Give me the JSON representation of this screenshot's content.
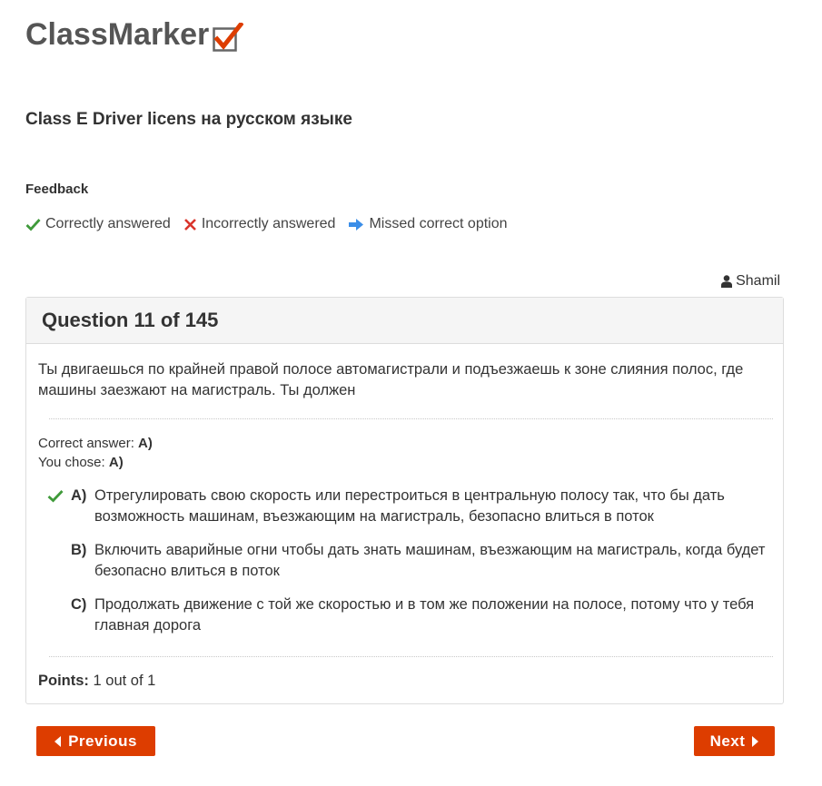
{
  "brand": {
    "logo_text": "ClassMarker",
    "accent_color": "#dd3d00"
  },
  "test": {
    "title": "Class E Driver licens на русском языке"
  },
  "feedback": {
    "title": "Feedback",
    "legend": {
      "correct": "Correctly answered",
      "incorrect": "Incorrectly answered",
      "missed": "Missed correct option"
    }
  },
  "user": {
    "name": "Shamil",
    "icon": "user-icon"
  },
  "question": {
    "heading": "Question 11 of 145",
    "text": "Ты двигаешься по крайней правой полосе автомагистрали и подъезжаешь к зоне слияния полос, где машины заезжают на магистраль. Ты должен",
    "correct_answer_label": "Correct answer:",
    "correct_answer_value": "A)",
    "you_chose_label": "You chose:",
    "you_chose_value": "A)",
    "options": [
      {
        "letter": "A)",
        "text": "Отрегулировать свою скорость или перестроиться в центральную полосу так, что бы дать возможность машинам, въезжающим на магистраль, безопасно влиться в поток",
        "mark": "check-icon"
      },
      {
        "letter": "B)",
        "text": "Включить аварийные огни чтобы дать знать машинам, въезжающим на магистраль, когда будет безопасно влиться в поток"
      },
      {
        "letter": "C)",
        "text": "Продолжать движение с той же скоростью и в том же положении на полосе, потому что у тебя главная дорога"
      }
    ],
    "points_label": "Points:",
    "points_value": "1 out of 1"
  },
  "navigation": {
    "previous_label": "Previous",
    "next_label": "Next"
  }
}
